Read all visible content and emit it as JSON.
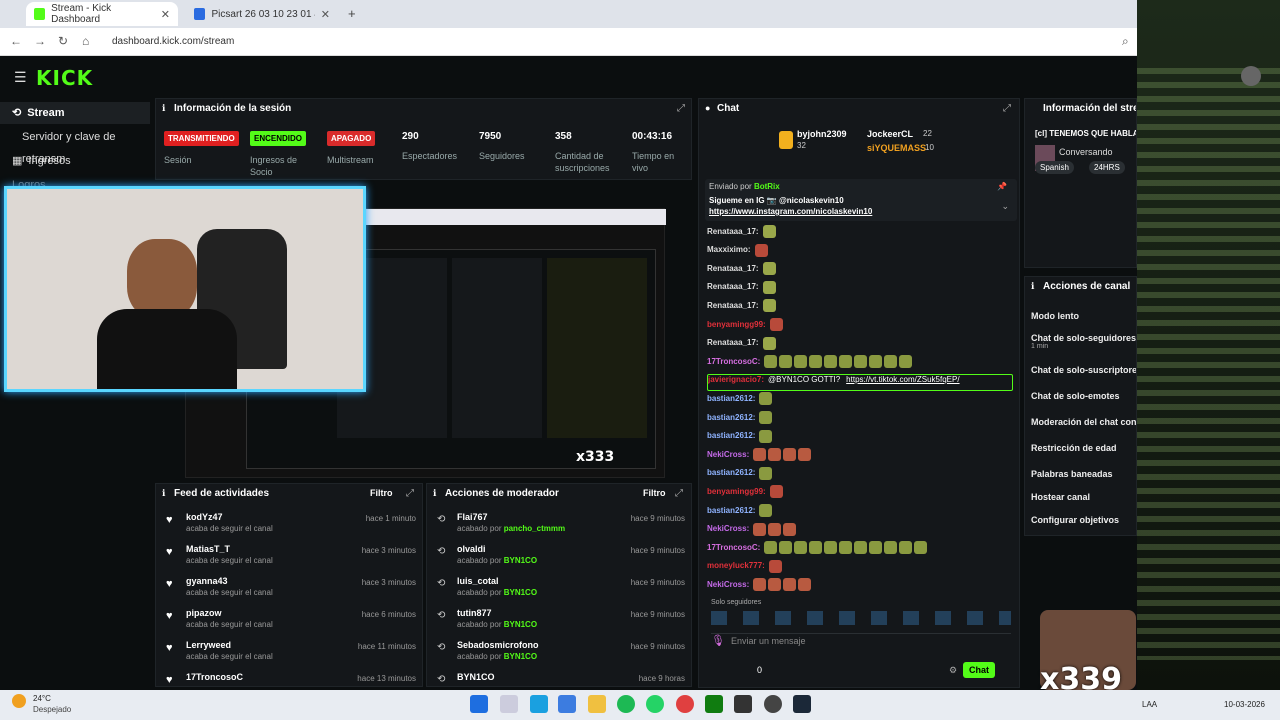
{
  "browser": {
    "tabs": [
      {
        "title": "Stream - Kick Dashboard",
        "active": true
      },
      {
        "title": "Picsart 26 03 10 23 01 46 589 (",
        "active": false
      }
    ],
    "url": "dashboard.kick.com/stream"
  },
  "app": {
    "logo": "KICK",
    "brand_color": "#53fc18"
  },
  "sidebar": {
    "items": [
      {
        "label": "Stream",
        "icon": "broadcast-icon"
      },
      {
        "label": "Servidor y clave de retransm"
      },
      {
        "label": "Ingresos",
        "icon": "money-icon"
      },
      {
        "label": "Logros"
      }
    ]
  },
  "session": {
    "title": "Información de la sesión",
    "statuses": [
      {
        "badge": "TRANSMITIENDO",
        "label": "Sesión",
        "color": "#e02020"
      },
      {
        "badge": "ENCENDIDO",
        "label": "Ingresos de Socio",
        "color": "#53fc18"
      },
      {
        "badge": "APAGADO",
        "label": "Multistream",
        "color": "#d92b2b"
      }
    ],
    "stats": [
      {
        "value": "290",
        "label": "Espectadores"
      },
      {
        "value": "7950",
        "label": "Seguidores"
      },
      {
        "value": "358",
        "label": "Cantidad de suscripciones"
      },
      {
        "value": "00:43:16",
        "label": "Tiempo en vivo"
      }
    ]
  },
  "feed": {
    "title": "Feed de actividades",
    "filter": "Filtro",
    "items": [
      {
        "name": "kodYz47",
        "sub": "acaba de seguir el canal",
        "time": "hace 1 minuto"
      },
      {
        "name": "MatiasT_T",
        "sub": "acaba de seguir el canal",
        "time": "hace 3 minutos"
      },
      {
        "name": "gyanna43",
        "sub": "acaba de seguir el canal",
        "time": "hace 3 minutos"
      },
      {
        "name": "pipazow",
        "sub": "acaba de seguir el canal",
        "time": "hace 6 minutos"
      },
      {
        "name": "Lerryweed",
        "sub": "acaba de seguir el canal",
        "time": "hace 11 minutos"
      },
      {
        "name": "17TroncosoC",
        "sub": "",
        "time": "hace 13 minutos"
      }
    ]
  },
  "mod": {
    "title": "Acciones de moderador",
    "filter": "Filtro",
    "items": [
      {
        "name": "Flai767",
        "sub": "acabado por",
        "by": "pancho_ctmmm",
        "time": "hace 9 minutos"
      },
      {
        "name": "olvaldi",
        "sub": "acabado por",
        "by": "BYN1CO",
        "time": "hace 9 minutos"
      },
      {
        "name": "luis_cotal",
        "sub": "acabado por",
        "by": "BYN1CO",
        "time": "hace 9 minutos"
      },
      {
        "name": "tutin877",
        "sub": "acabado por",
        "by": "BYN1CO",
        "time": "hace 9 minutos"
      },
      {
        "name": "Sebadosmicrofono",
        "sub": "acabado por",
        "by": "BYN1CO",
        "time": "hace 9 minutos"
      },
      {
        "name": "BYN1CO",
        "sub": "",
        "by": "",
        "time": "hace 9 horas"
      }
    ]
  },
  "chat": {
    "title": "Chat",
    "top": [
      {
        "name": "byjohn2309",
        "count": "32"
      },
      {
        "name": "JockeerCL",
        "count": "22"
      },
      {
        "name": "siYQUEMASS",
        "count": "10"
      }
    ],
    "pinned_by_label": "Enviado por",
    "pinned_by": "BotRix",
    "pinned_text1": "Sigueme en IG 📷 @nicolaskevin10",
    "pinned_link": "https://www.instagram.com/nicolaskevin10",
    "lines": [
      {
        "user": "Renataaa_17:",
        "color": "#ddd"
      },
      {
        "user": "Maxxiximo:",
        "color": "#ddd"
      },
      {
        "user": "Renataaa_17:",
        "color": "#ddd"
      },
      {
        "user": "Renataaa_17:",
        "color": "#ddd"
      },
      {
        "user": "Renataaa_17:",
        "color": "#ddd"
      },
      {
        "user": "benyamingg99:",
        "color": "#e0303a"
      },
      {
        "user": "Renataaa_17:",
        "color": "#ddd"
      },
      {
        "user": "17TroncosoC:",
        "color": "#d66ee0"
      },
      {
        "user": "javierignacio7:",
        "color": "#e0303a"
      },
      {
        "user": "bastian2612:",
        "color": "#8fb3ff"
      },
      {
        "user": "bastian2612:",
        "color": "#8fb3ff"
      },
      {
        "user": "bastian2612:",
        "color": "#8fb3ff"
      },
      {
        "user": "NekiCross:",
        "color": "#c46ae8"
      },
      {
        "user": "bastian2612:",
        "color": "#8fb3ff"
      },
      {
        "user": "benyamingg99:",
        "color": "#e0303a"
      },
      {
        "user": "bastian2612:",
        "color": "#8fb3ff"
      },
      {
        "user": "NekiCross:",
        "color": "#c46ae8"
      },
      {
        "user": "17TroncosoC:",
        "color": "#d66ee0"
      },
      {
        "user": "moneyluck777:",
        "color": "#e0303a"
      },
      {
        "user": "NekiCross:",
        "color": "#c46ae8"
      }
    ],
    "highlight_text": "@BYN1CO GOTTI?",
    "highlight_link": "https://vt.tiktok.com/ZSuk5fqEP/",
    "followers_only": "Solo seguidores",
    "input_placeholder": "Enviar un mensaje",
    "send": "Chat",
    "count": "0"
  },
  "streaminfo": {
    "title": "Información del stream",
    "stream_title": "[cl] TENEMOS QUE HABLAR",
    "category": "Conversando",
    "tags": [
      "Spanish",
      "24HRS"
    ]
  },
  "channel_actions": {
    "title": "Acciones de canal",
    "items": [
      {
        "label": "Modo lento",
        "sub": ""
      },
      {
        "label": "Chat de solo-seguidores",
        "sub": "1 min"
      },
      {
        "label": "Chat de solo-suscriptores",
        "sub": ""
      },
      {
        "label": "Chat de solo-emotes",
        "sub": ""
      },
      {
        "label": "Moderación del chat con IA",
        "sub": ""
      },
      {
        "label": "Restricción de edad",
        "sub": ""
      },
      {
        "label": "Palabras baneadas",
        "sub": ""
      },
      {
        "label": "Hostear canal",
        "sub": ""
      },
      {
        "label": "Configurar objetivos",
        "sub": ""
      }
    ]
  },
  "overlay": {
    "counter1": "x333",
    "counter2": "x339"
  },
  "taskbar": {
    "temp": "24°C",
    "weather": "Despejado",
    "lang": "LAA",
    "date": "10-03-2026"
  }
}
